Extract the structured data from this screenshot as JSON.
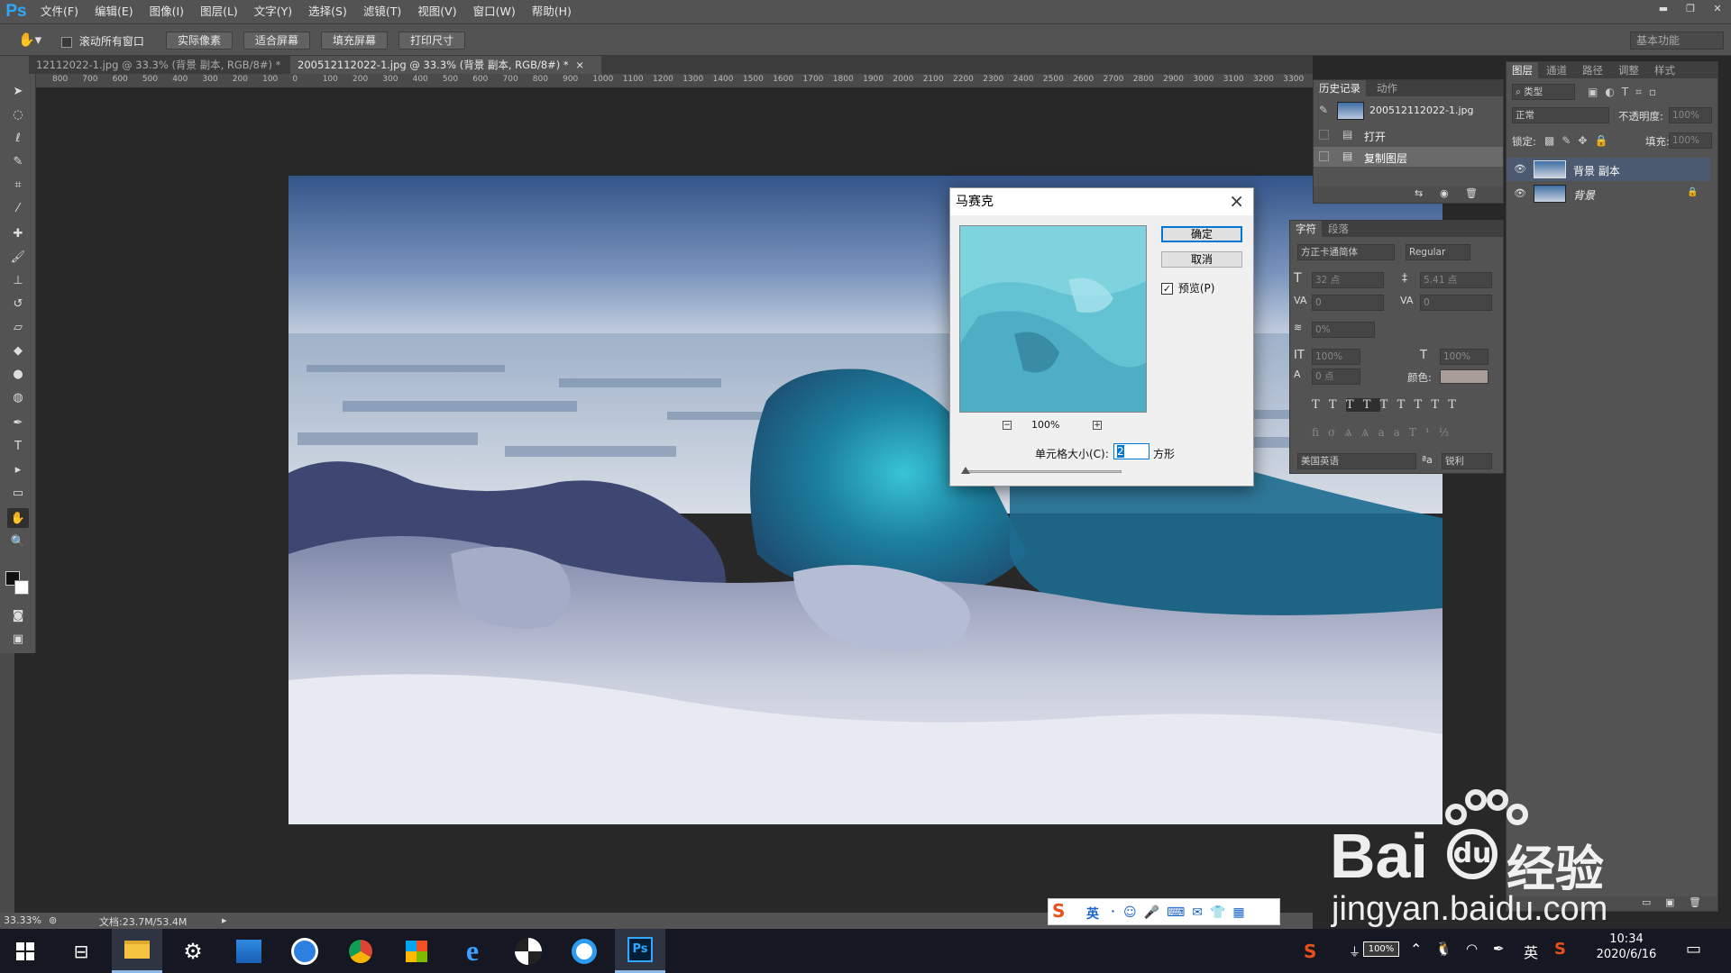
{
  "menubar": {
    "logo": "Ps",
    "items": [
      "文件(F)",
      "编辑(E)",
      "图像(I)",
      "图层(L)",
      "文字(Y)",
      "选择(S)",
      "滤镜(T)",
      "视图(V)",
      "窗口(W)",
      "帮助(H)"
    ]
  },
  "options": {
    "scroll_all": "滚动所有窗口",
    "btn_actual": "实际像素",
    "btn_fit": "适合屏幕",
    "btn_fill": "填充屏幕",
    "btn_print": "打印尺寸",
    "workspace": "基本功能"
  },
  "tabs": [
    {
      "label": "12112022-1.jpg @ 33.3% (背景 副本, RGB/8#) *"
    },
    {
      "label": "200512112022-1.jpg @ 33.3% (背景 副本, RGB/8#) *"
    }
  ],
  "ruler_ticks": [
    "800",
    "700",
    "600",
    "500",
    "400",
    "300",
    "200",
    "100",
    "0",
    "100",
    "200",
    "300",
    "400",
    "500",
    "600",
    "700",
    "800",
    "900",
    "1000",
    "1100",
    "1200",
    "1300",
    "1400",
    "1500",
    "1600",
    "1700",
    "1800",
    "1900",
    "2000",
    "2100",
    "2200",
    "2300",
    "2400",
    "2500",
    "2600",
    "2700",
    "2800",
    "2900",
    "3000",
    "3100",
    "3200",
    "3300"
  ],
  "status": {
    "zoom": "33.33%",
    "doc": "文档:23.7M/53.4M"
  },
  "dialog": {
    "title": "马赛克",
    "ok": "确定",
    "cancel": "取消",
    "preview_label": "预览(P)",
    "preview_checked": true,
    "zoom": "100%",
    "cell_size_label": "单元格大小(C):",
    "cell_size_value": "2",
    "cell_unit": "方形",
    "slider_fraction": 0.01
  },
  "history_panel": {
    "tabs": [
      "历史记录",
      "动作"
    ],
    "snapshot": "200512112022-1.jpg",
    "items": [
      "打开",
      "复制图层"
    ]
  },
  "layers_panel": {
    "tabs": [
      "图层",
      "通道",
      "路径",
      "调整",
      "样式"
    ],
    "filter": "类型",
    "blend_mode": "正常",
    "opacity_label": "不透明度:",
    "opacity_value": "100%",
    "lock_label": "锁定:",
    "fill_label": "填充:",
    "fill_value": "100%",
    "layers": [
      {
        "name": "背景 副本",
        "selected": true
      },
      {
        "name": "背景",
        "selected": false
      }
    ]
  },
  "char_panel": {
    "tabs": [
      "字符",
      "段落"
    ],
    "font": "方正卡通简体",
    "style": "Regular",
    "size": "32 点",
    "leading": "5.41 点",
    "kerning": "0",
    "tracking": "0",
    "scale_percent": "0%",
    "v_scale": "100%",
    "h_scale": "100%",
    "baseline": "0 点",
    "color_label": "颜色:",
    "language": "美国英语",
    "aa_label": "ªa",
    "aa": "锐利"
  },
  "ime": {
    "lang": "英"
  },
  "taskbar": {
    "battery": "100%",
    "ime_lang": "英",
    "time": "10:34",
    "date": "2020/6/16"
  },
  "watermark": {
    "brand": "Bai",
    "brand2": "经验",
    "url": "jingyan.baidu.com"
  },
  "colors": {
    "ps_blue": "#31a8ff",
    "panel": "#535353",
    "background": "#282828",
    "selected_layer": "#4b5a70"
  }
}
